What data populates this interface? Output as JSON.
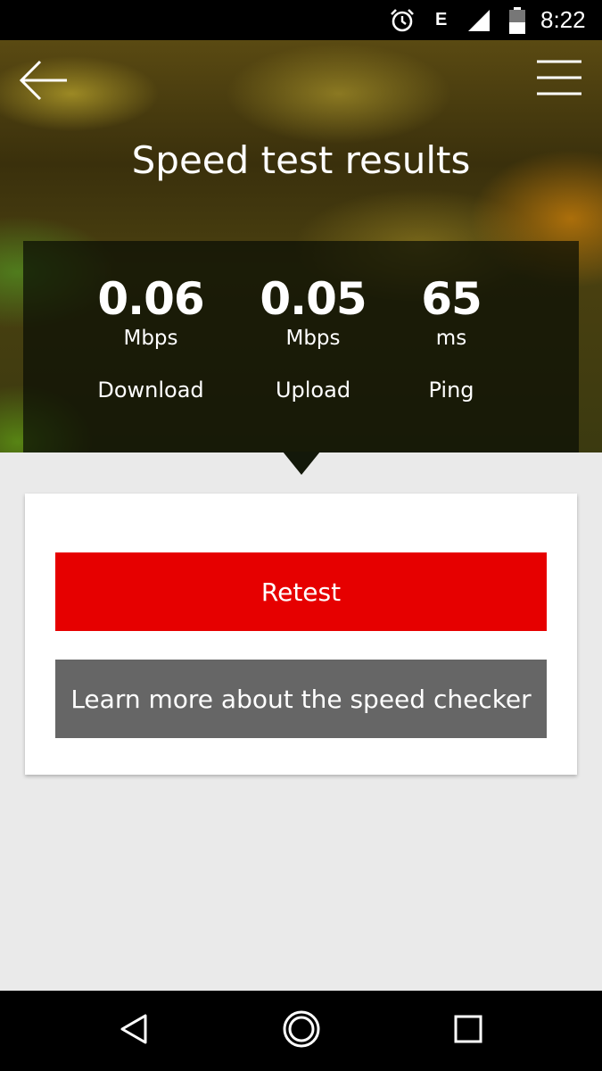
{
  "status_bar": {
    "network": "E",
    "time": "8:22",
    "icons": [
      "alarm-icon",
      "signal-icon",
      "battery-icon"
    ]
  },
  "header": {
    "title": "Speed test results",
    "back_icon": "arrow-left-icon",
    "menu_icon": "hamburger-menu-icon"
  },
  "results": {
    "download": {
      "value": "0.06",
      "unit": "Mbps",
      "label": "Download"
    },
    "upload": {
      "value": "0.05",
      "unit": "Mbps",
      "label": "Upload"
    },
    "ping": {
      "value": "65",
      "unit": "ms",
      "label": "Ping"
    }
  },
  "actions": {
    "retest_label": "Retest",
    "learn_label": "Learn more about the speed checker"
  },
  "colors": {
    "primary_button": "#e60000",
    "secondary_button": "#666666",
    "page_background": "#eaeaea"
  },
  "nav_bar": {
    "icons": [
      "nav-back-icon",
      "nav-home-icon",
      "nav-recents-icon"
    ]
  }
}
